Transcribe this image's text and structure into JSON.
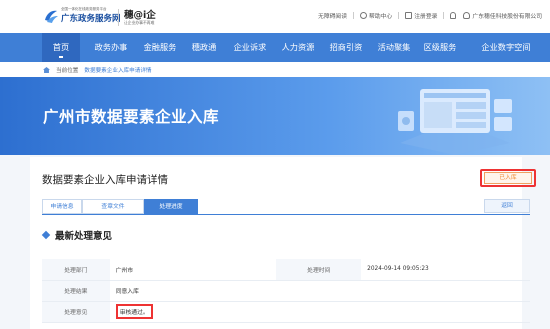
{
  "header": {
    "logo_small": "全国一体化在线政务服务平台",
    "logo_big": "广东政务服务网",
    "brand": "穗@i企",
    "brand_sub": "让企业办事不再难",
    "links": [
      "无障碍阅读",
      "帮助中心",
      "注册登录"
    ],
    "user": "广东穗佳科技股份有限公司"
  },
  "nav": {
    "items": [
      "首页",
      "政务办事",
      "金融服务",
      "穗政通",
      "企业诉求",
      "人力资源",
      "招商引资",
      "活动聚集",
      "区级服务",
      "企业数字空间"
    ],
    "active_index": 0
  },
  "breadcrumb": {
    "prefix": "当前位置",
    "current": "数据要素企业入库申请详情"
  },
  "banner": {
    "title": "广州市数据要素企业入库"
  },
  "detail": {
    "title": "数据要素企业入库申请详情",
    "status": "已入库",
    "tabs": [
      "申请信息",
      "查章文件",
      "处理进度"
    ],
    "active_tab": 2,
    "return_label": "返回",
    "section_title": "最新处理意见",
    "rows": [
      {
        "label": "处理部门",
        "value": "广州市",
        "label2": "处理时间",
        "value2": "2024-09-14 09:05:23"
      },
      {
        "label": "处理结果",
        "value": "同意入库"
      },
      {
        "label": "处理意见",
        "value": "审核通过。"
      }
    ]
  },
  "colors": {
    "primary": "#3f7fd6",
    "nav_active": "#2f68bf",
    "highlight_red": "#ee3333",
    "status_orange": "#f08a30"
  }
}
